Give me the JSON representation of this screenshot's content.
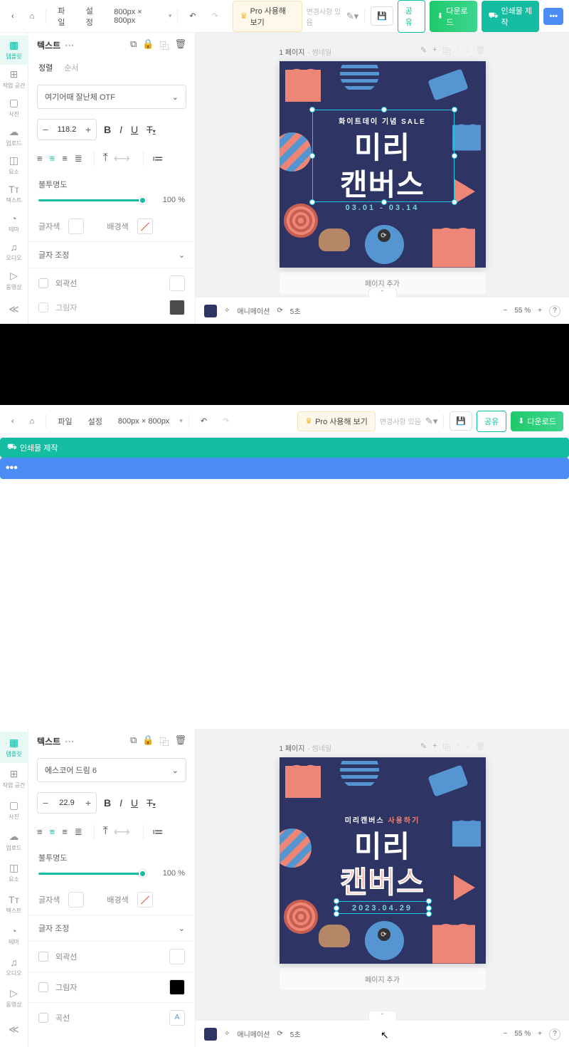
{
  "top": {
    "file": "파일",
    "settings": "설정",
    "dims": "800px × 800px",
    "pro": "Pro 사용해 보기",
    "status": "변경사항 있음",
    "share": "공유",
    "download": "다운로드",
    "print": "인쇄물 제작",
    "more": "•••"
  },
  "nav": {
    "template": "템플릿",
    "workspace": "작업 공간",
    "photo": "사진",
    "upload": "업로드",
    "element": "요소",
    "text": "텍스트",
    "theme": "테마",
    "audio": "오디오",
    "video": "동영상"
  },
  "panel": {
    "tab": "텍스트",
    "sub1": "정렬",
    "sub2": "순서",
    "opacity_label": "불투명도",
    "opacity_val": "100 %",
    "text_color": "글자색",
    "bg_color": "배경색",
    "letter_spacing": "글자 조정",
    "outline": "외곽선",
    "shadow": "그림자",
    "curve": "곡선"
  },
  "inst1": {
    "font": "여기어때 잘난체 OTF",
    "size": "118.2",
    "canvas": {
      "page": "1 페이지",
      "page_sub": "- 썸네일",
      "t1": "화이트데이 기념 SALE",
      "t2": "미리",
      "t3": "캔버스",
      "t4": "03.01 - 03.14",
      "add_page": "페이지 추가"
    }
  },
  "inst2": {
    "font": "에스코어 드림 6",
    "size": "22.9",
    "canvas": {
      "page": "1 페이지",
      "page_sub": "- 썸네일",
      "t1": "미리캔버스 사용하기",
      "t2": "미리",
      "t3": "캔버스",
      "t4": "2023.04.29",
      "add_page": "페이지 추가"
    }
  },
  "bottom": {
    "anim": "애니메이션",
    "dur": "5초",
    "zoom": "55 %"
  }
}
